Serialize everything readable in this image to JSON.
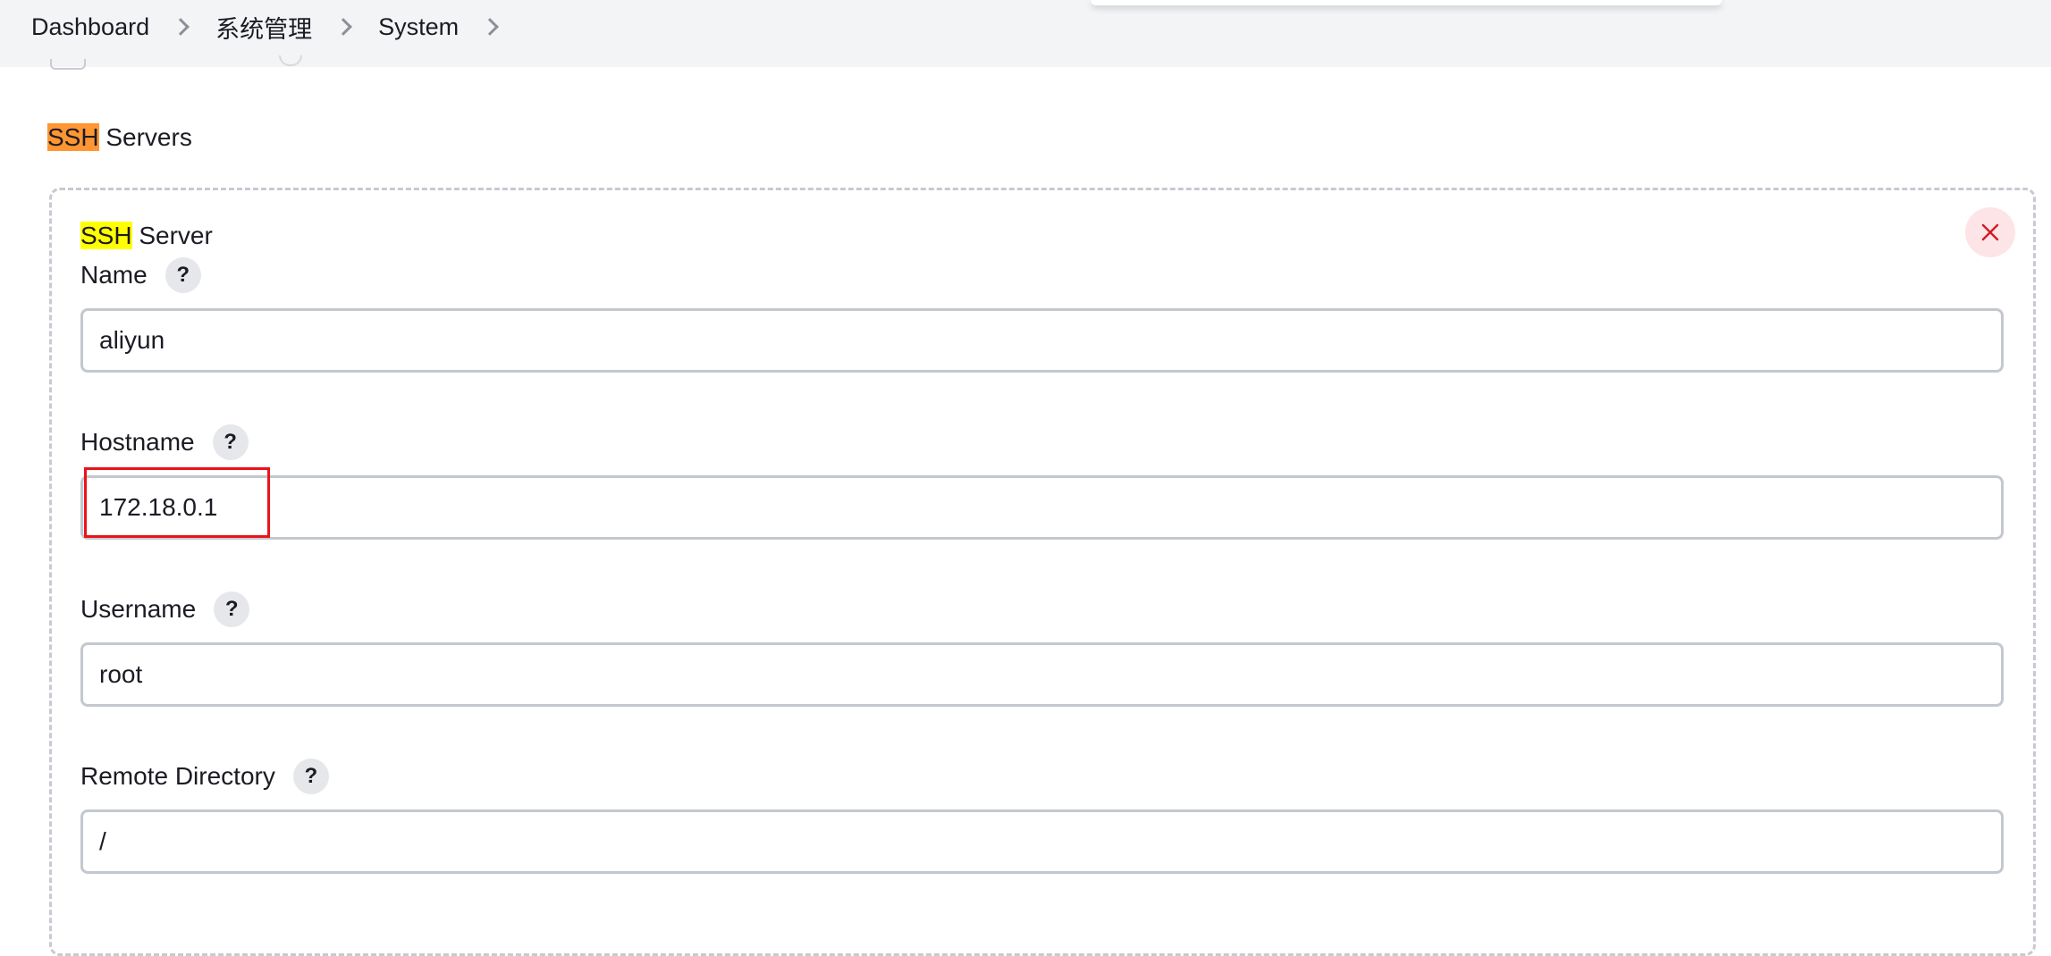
{
  "breadcrumb": {
    "items": [
      "Dashboard",
      "系统管理",
      "System"
    ]
  },
  "section": {
    "title_highlight": "SSH",
    "title_rest": " Servers"
  },
  "server_panel": {
    "title_highlight": "SSH",
    "title_rest": " Server",
    "close_icon": "close-icon",
    "help_glyph": "?",
    "fields": {
      "name": {
        "label": "Name",
        "value": "aliyun"
      },
      "hostname": {
        "label": "Hostname",
        "value": "172.18.0.1"
      },
      "username": {
        "label": "Username",
        "value": "root"
      },
      "remote_directory": {
        "label": "Remote Directory",
        "value": "/"
      }
    }
  },
  "colors": {
    "search_highlight_current": "#ff9632",
    "search_highlight": "#ffff00",
    "annotation_box": "#e8141a",
    "close_button": "#fde4e6",
    "close_icon": "#d11a2a"
  }
}
